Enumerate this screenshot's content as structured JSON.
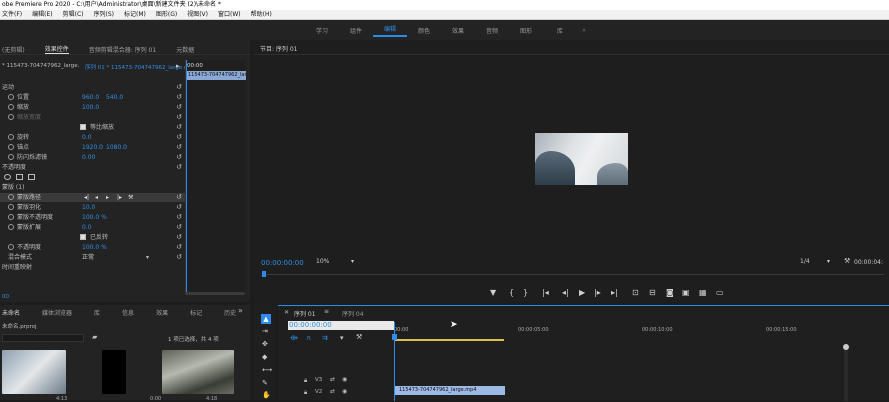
{
  "app": {
    "title": "obe Premiere Pro 2020 - C:\\用户\\Administrator\\桌面\\新建文件夹 (2)\\未命名 *"
  },
  "menu": [
    "文件(F)",
    "编辑(E)",
    "剪辑(C)",
    "序列(S)",
    "标记(M)",
    "图形(G)",
    "视图(V)",
    "窗口(W)",
    "帮助(H)"
  ],
  "workspaces": {
    "items": [
      "学习",
      "组件",
      "编辑",
      "颜色",
      "效果",
      "音频",
      "图形",
      "库"
    ],
    "active_index": 2,
    "more": "»"
  },
  "source_panel": {
    "tabs": [
      "(无剪辑)",
      "效果控件",
      "音频剪辑混合器: 序列 01",
      "元数据"
    ],
    "active_tab": 1,
    "source_label": "* 115473-704747962_large.",
    "seq_label": "序列 01 * 115473-704747962_large.mp4",
    "time_start": "00:00",
    "clip_label": "115473-704747962_larg"
  },
  "effect_controls": {
    "rows": [
      {
        "indent": 1,
        "label": "运动",
        "v1": "",
        "v2": "",
        "reset": true
      },
      {
        "indent": 2,
        "label": "位置",
        "v1": "960.0",
        "v2": "540.0",
        "reset": true,
        "stopwatch": true
      },
      {
        "indent": 2,
        "label": "缩放",
        "v1": "100.0",
        "v2": "",
        "reset": true,
        "stopwatch": true
      },
      {
        "indent": 2,
        "label": "缩放宽度",
        "v1": "",
        "v2": "",
        "reset": true,
        "stopwatch": true,
        "dim": true
      },
      {
        "indent": 3,
        "label": "等比缩放",
        "v1": "",
        "v2": "",
        "reset": true,
        "checkbox": true
      },
      {
        "indent": 2,
        "label": "旋转",
        "v1": "0.0",
        "v2": "",
        "reset": true,
        "stopwatch": true
      },
      {
        "indent": 2,
        "label": "锚点",
        "v1": "1920.0",
        "v2": "1080.0",
        "reset": true,
        "stopwatch": true
      },
      {
        "indent": 2,
        "label": "防闪烁滤镜",
        "v1": "0.00",
        "v2": "",
        "reset": true,
        "stopwatch": true
      },
      {
        "indent": 1,
        "label": "不透明度",
        "v1": "",
        "v2": "",
        "reset": true
      },
      {
        "indent": 1,
        "label": "",
        "v1": "",
        "v2": "",
        "reset": false,
        "shapes": true
      },
      {
        "indent": 1,
        "label": "蒙版 (1)",
        "v1": "",
        "v2": "",
        "reset": false
      },
      {
        "indent": 2,
        "label": "蒙版路径",
        "v1": "",
        "v2": "",
        "reset": true,
        "stopwatch": true,
        "selected": true,
        "keys": true
      },
      {
        "indent": 2,
        "label": "蒙版羽化",
        "v1": "10.0",
        "v2": "",
        "reset": true,
        "stopwatch": true
      },
      {
        "indent": 2,
        "label": "蒙版不透明度",
        "v1": "100.0 %",
        "v2": "",
        "reset": true,
        "stopwatch": true
      },
      {
        "indent": 2,
        "label": "蒙版扩展",
        "v1": "0.0",
        "v2": "",
        "reset": true,
        "stopwatch": true
      },
      {
        "indent": 3,
        "label": "已反转",
        "v1": "",
        "v2": "",
        "reset": true,
        "checkbox": true
      },
      {
        "indent": 2,
        "label": "不透明度",
        "v1": "100.0 %",
        "v2": "",
        "reset": true,
        "stopwatch": true
      },
      {
        "indent": 2,
        "label": "混合模式",
        "v1": "正常",
        "v2": "",
        "reset": true,
        "dropdown": true
      },
      {
        "indent": 1,
        "label": "时间重映射",
        "v1": "",
        "v2": "",
        "reset": false
      }
    ],
    "bottom_time": "00"
  },
  "program_monitor": {
    "title": "节目: 序列 01",
    "timecode": "00:00:00:00",
    "zoom": "10%",
    "resolution": "1/4",
    "end_time": "00:00:04:"
  },
  "project_panel": {
    "tabs": [
      "未命名",
      "媒体浏览器",
      "库",
      "信息",
      "效果",
      "标记",
      "历史"
    ],
    "file": "未命名.prproj",
    "selection": "1 项已选择，共 4 项",
    "clip_durations": [
      "4:13",
      "",
      "0:00",
      "4:18"
    ]
  },
  "timeline": {
    "tabs": [
      "序列 01",
      "序列 04"
    ],
    "timecode": "00:00:00:00",
    "ruler": [
      "00:00",
      "00:00:05:00",
      "00:00:10:00",
      "00:00:15:00"
    ],
    "tracks": [
      {
        "name": "V3"
      },
      {
        "name": "V2"
      }
    ],
    "clip_label": "115473-704747962_large.mp4"
  },
  "colors": {
    "accent": "#2d8ceb",
    "panel": "#232323",
    "selected_row": "#3a3a3a",
    "clip": "#9bb9e4"
  }
}
